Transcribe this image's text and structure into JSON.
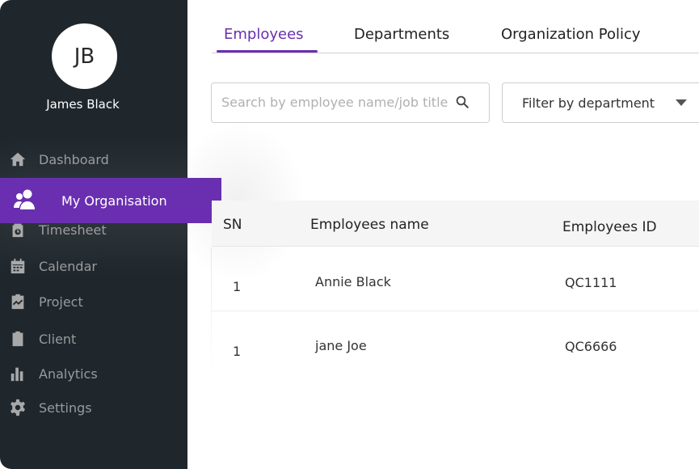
{
  "user": {
    "initials": "JB",
    "name": "James Black"
  },
  "sidebar": {
    "items": [
      {
        "label": "Dashboard",
        "icon": "home-icon"
      },
      {
        "label": "My Organisation",
        "icon": "users-icon",
        "active": true
      },
      {
        "label": "Timesheet",
        "icon": "timesheet-icon"
      },
      {
        "label": "Calendar",
        "icon": "calendar-icon"
      },
      {
        "label": "Project",
        "icon": "project-clipboard-icon"
      },
      {
        "label": "Client",
        "icon": "client-clipboard-icon"
      },
      {
        "label": "Analytics",
        "icon": "bar-chart-icon"
      },
      {
        "label": "Settings",
        "icon": "gear-icon"
      }
    ]
  },
  "tabs": [
    {
      "label": "Employees",
      "active": true
    },
    {
      "label": "Departments"
    },
    {
      "label": "Organization Policy"
    }
  ],
  "search": {
    "placeholder": "Search by employee name/job title",
    "value": ""
  },
  "filter": {
    "label": "Filter by department"
  },
  "table": {
    "headers": [
      "SN",
      "Employees name",
      "Employees ID"
    ],
    "rows": [
      {
        "sn": "1",
        "name": "Annie Black",
        "id": "QC1111"
      },
      {
        "sn": "1",
        "name": "jane Joe",
        "id": "QC6666"
      }
    ]
  },
  "colors": {
    "accent": "#6a2fb0",
    "sidebar_bg": "#1f272d"
  }
}
